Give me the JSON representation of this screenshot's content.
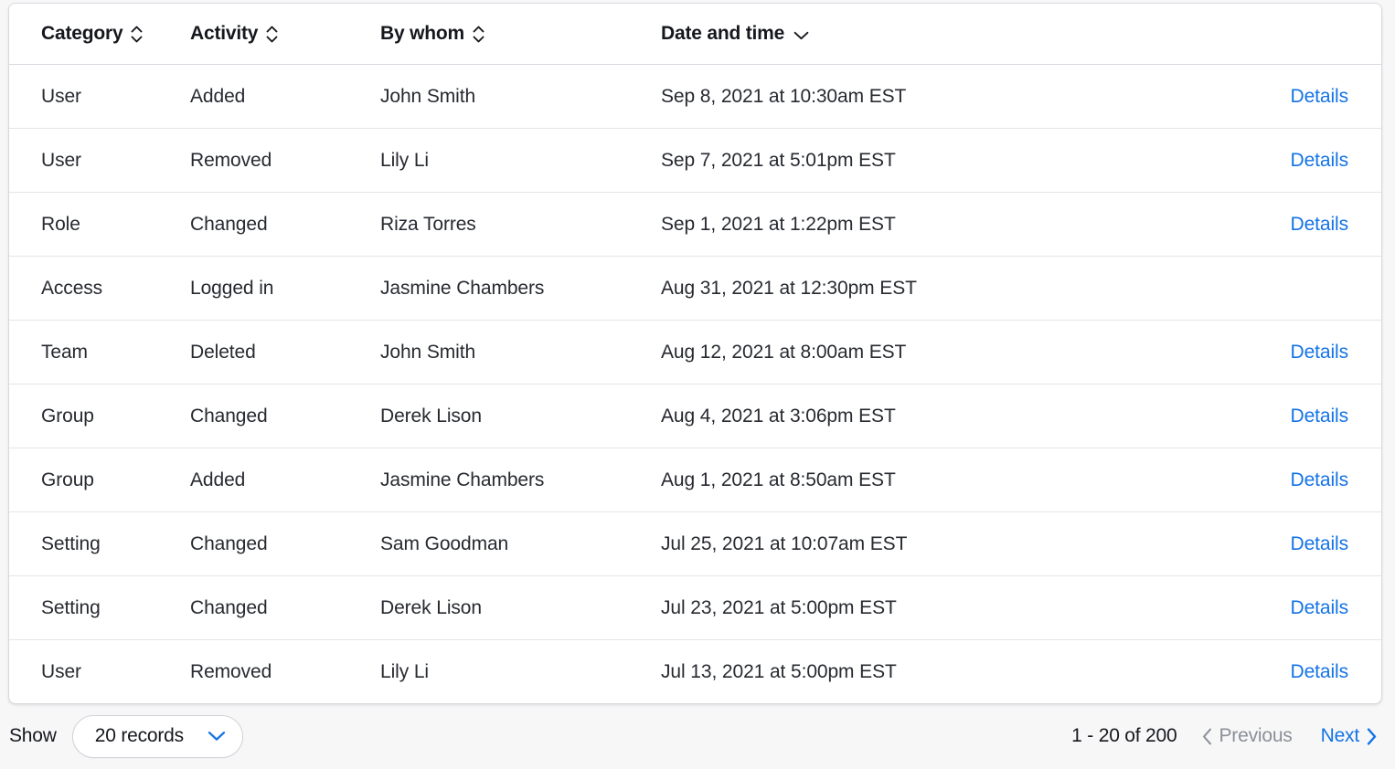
{
  "table": {
    "columns": [
      {
        "key": "category",
        "label": "Category",
        "sort_icon": "sort-updown-icon",
        "sorted": false
      },
      {
        "key": "activity",
        "label": "Activity",
        "sort_icon": "sort-updown-icon",
        "sorted": false
      },
      {
        "key": "bywhom",
        "label": "By whom",
        "sort_icon": "sort-updown-icon",
        "sorted": false
      },
      {
        "key": "date",
        "label": "Date and time",
        "sort_icon": "chevron-down-icon",
        "sorted": true
      },
      {
        "key": "details",
        "label": "",
        "sort_icon": "",
        "sorted": false
      }
    ],
    "rows": [
      {
        "category": "User",
        "activity": "Added",
        "bywhom": "John Smith",
        "date": "Sep 8, 2021 at 10:30am EST",
        "details": "Details"
      },
      {
        "category": "User",
        "activity": "Removed",
        "bywhom": "Lily Li",
        "date": "Sep 7, 2021 at 5:01pm EST",
        "details": "Details"
      },
      {
        "category": "Role",
        "activity": "Changed",
        "bywhom": "Riza Torres",
        "date": "Sep 1, 2021 at 1:22pm EST",
        "details": "Details"
      },
      {
        "category": "Access",
        "activity": "Logged in",
        "bywhom": "Jasmine Chambers",
        "date": "Aug 31, 2021 at 12:30pm EST",
        "details": ""
      },
      {
        "category": "Team",
        "activity": "Deleted",
        "bywhom": "John Smith",
        "date": "Aug 12, 2021 at 8:00am EST",
        "details": "Details"
      },
      {
        "category": "Group",
        "activity": "Changed",
        "bywhom": "Derek Lison",
        "date": "Aug 4, 2021 at 3:06pm EST",
        "details": "Details"
      },
      {
        "category": "Group",
        "activity": "Added",
        "bywhom": "Jasmine Chambers",
        "date": "Aug 1, 2021 at 8:50am EST",
        "details": "Details"
      },
      {
        "category": "Setting",
        "activity": "Changed",
        "bywhom": "Sam Goodman",
        "date": "Jul 25, 2021 at 10:07am EST",
        "details": "Details"
      },
      {
        "category": "Setting",
        "activity": "Changed",
        "bywhom": "Derek Lison",
        "date": "Jul 23, 2021 at 5:00pm EST",
        "details": "Details"
      },
      {
        "category": "User",
        "activity": "Removed",
        "bywhom": "Lily Li",
        "date": "Jul 13, 2021 at 5:00pm EST",
        "details": "Details"
      }
    ]
  },
  "footer": {
    "show_label": "Show",
    "records_select": {
      "value": "20 records",
      "chevron_icon": "chevron-down-icon"
    },
    "pagination": {
      "range": "1 - 20 of 200",
      "previous_label": "Previous",
      "previous_icon": "chevron-left-icon",
      "previous_disabled": true,
      "next_label": "Next",
      "next_icon": "chevron-right-icon",
      "next_disabled": false
    }
  },
  "colors": {
    "link_blue": "#1473e6",
    "text_primary": "#16181d",
    "text_body": "#272a30",
    "text_disabled": "#8b9097",
    "border": "#d6d9de",
    "row_divider": "#e3e5e9",
    "page_bg": "#f7f7f8",
    "card_bg": "#ffffff"
  }
}
